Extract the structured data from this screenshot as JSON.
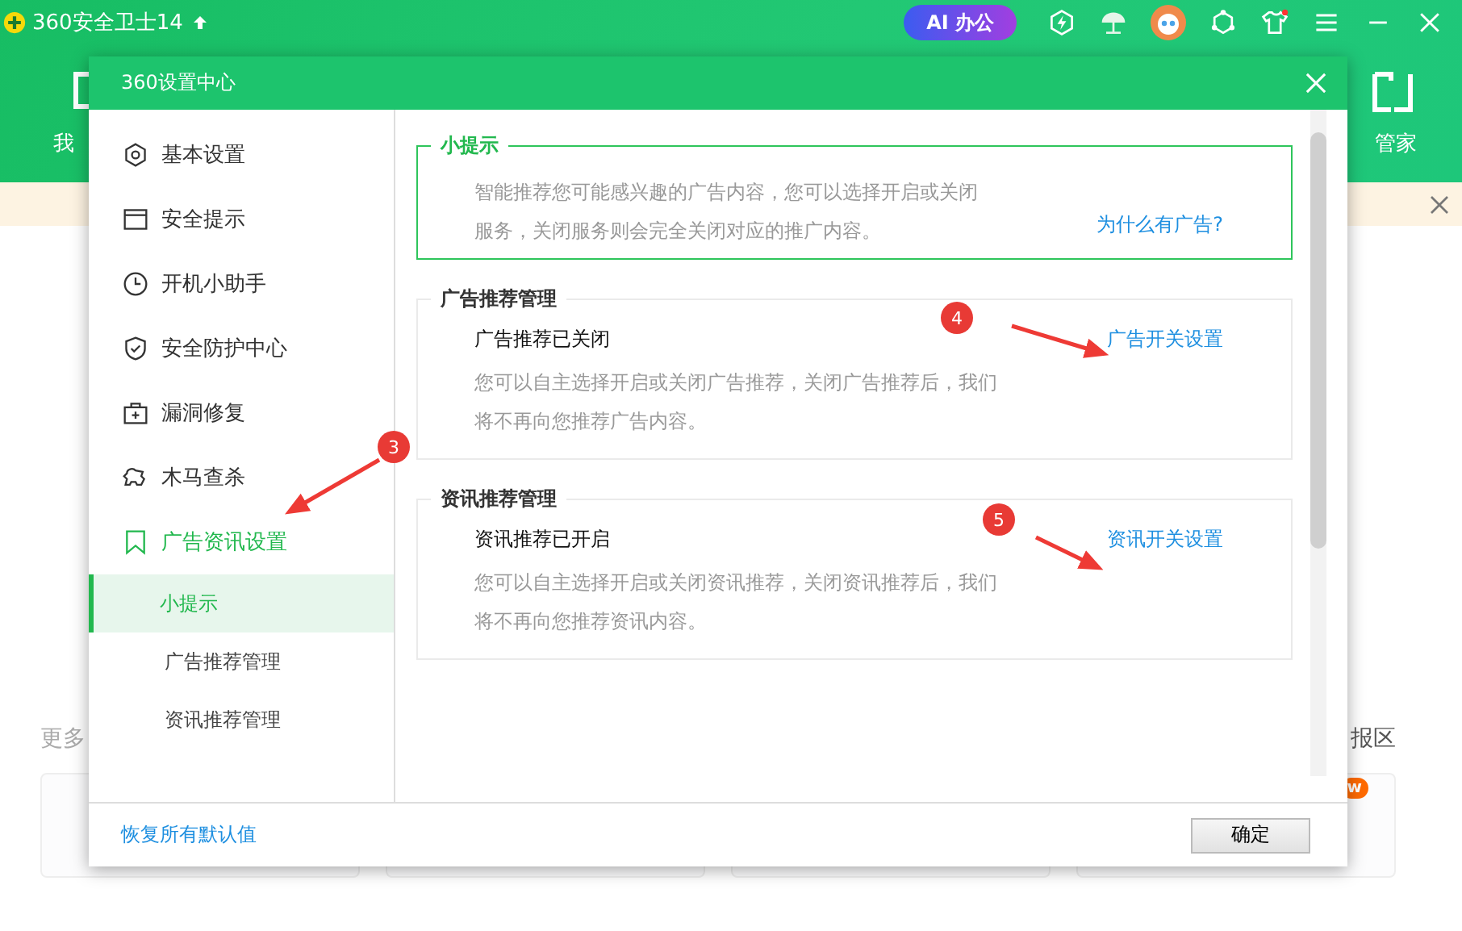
{
  "app": {
    "title": "360安全卫士14",
    "ai_button": "AI 办公",
    "nav_left": "我",
    "nav_right": "管家",
    "more_label": "更多",
    "right_label": "报区",
    "new_badge": "w"
  },
  "dialog": {
    "title": "360设置中心",
    "sidebar": {
      "items": [
        {
          "label": "基本设置",
          "selected": false
        },
        {
          "label": "安全提示",
          "selected": false
        },
        {
          "label": "开机小助手",
          "selected": false
        },
        {
          "label": "安全防护中心",
          "selected": false
        },
        {
          "label": "漏洞修复",
          "selected": false
        },
        {
          "label": "木马查杀",
          "selected": false
        },
        {
          "label": "广告资讯设置",
          "selected": true,
          "expanded": true,
          "children": [
            {
              "label": "小提示",
              "selected": true
            },
            {
              "label": "广告推荐管理",
              "selected": false
            },
            {
              "label": "资讯推荐管理",
              "selected": false
            }
          ]
        }
      ]
    },
    "tip": {
      "title": "小提示",
      "text": "智能推荐您可能感兴趣的广告内容，您可以选择开启或关闭服务，关闭服务则会完全关闭对应的推广内容。",
      "link": "为什么有广告?"
    },
    "sections": [
      {
        "title": "广告推荐管理",
        "status": "广告推荐已关闭",
        "link": "广告开关设置",
        "description": "您可以自主选择开启或关闭广告推荐，关闭广告推荐后，我们将不再向您推荐广告内容。"
      },
      {
        "title": "资讯推荐管理",
        "status": "资讯推荐已开启",
        "link": "资讯开关设置",
        "description": "您可以自主选择开启或关闭资讯推荐，关闭资讯推荐后，我们将不再向您推荐资讯内容。"
      }
    ],
    "restore_link": "恢复所有默认值",
    "ok_button": "确定"
  },
  "annotations": [
    {
      "number": "3"
    },
    {
      "number": "4"
    },
    {
      "number": "5"
    }
  ]
}
